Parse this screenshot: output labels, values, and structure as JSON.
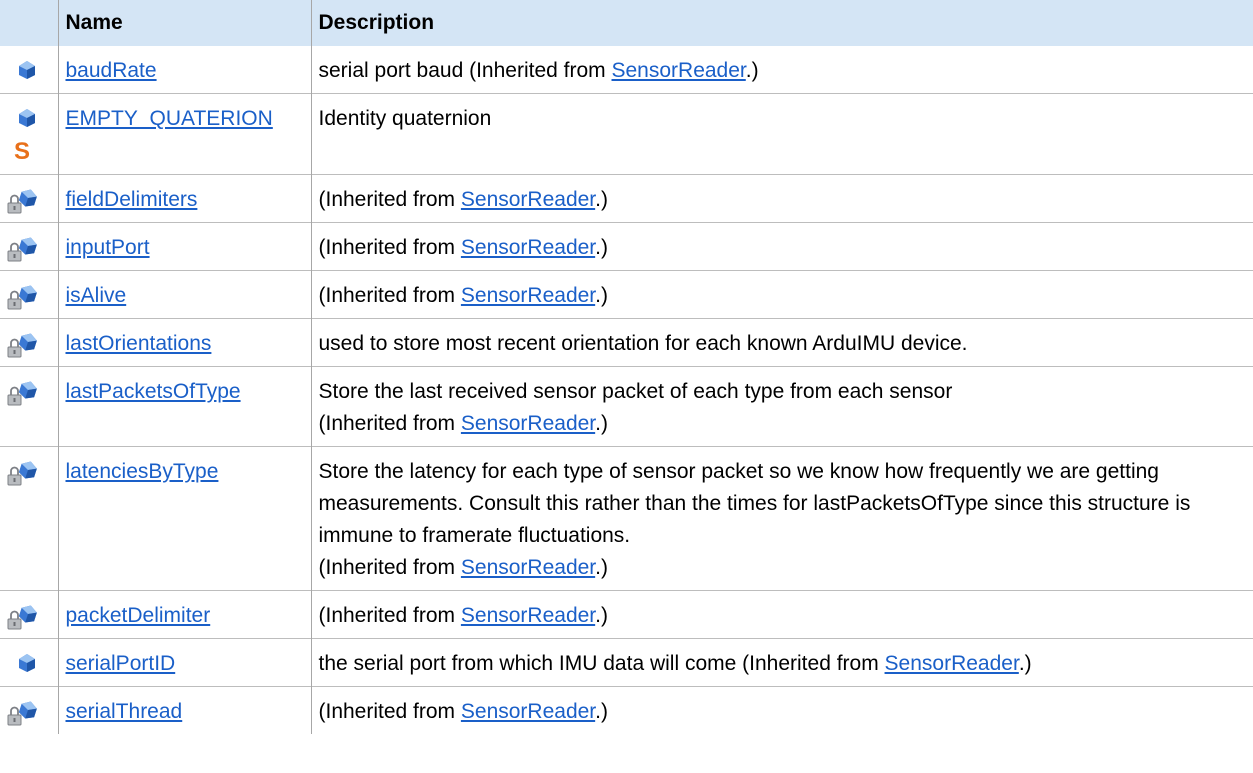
{
  "table": {
    "headers": {
      "name": "Name",
      "description": "Description"
    },
    "rows": [
      {
        "icon": "public-field-icon",
        "static": false,
        "name": "baudRate",
        "desc": "serial port baud",
        "inherited": true
      },
      {
        "icon": "public-field-icon",
        "static": true,
        "name": "EMPTY_QUATERION",
        "desc": "Identity quaternion",
        "inherited": false
      },
      {
        "icon": "protected-field-icon",
        "static": false,
        "name": "fieldDelimiters",
        "desc": "",
        "inherited": true
      },
      {
        "icon": "protected-field-icon",
        "static": false,
        "name": "inputPort",
        "desc": "",
        "inherited": true
      },
      {
        "icon": "protected-field-icon",
        "static": false,
        "name": "isAlive",
        "desc": "",
        "inherited": true
      },
      {
        "icon": "protected-field-icon",
        "static": false,
        "name": "lastOrientations",
        "desc": "used to store most recent orientation for each known ArduIMU device.",
        "inherited": false
      },
      {
        "icon": "protected-field-icon",
        "static": false,
        "name": "lastPacketsOfType",
        "desc": "Store the last received sensor packet of each type from each sensor",
        "inherited": true,
        "inheritedNewLine": true
      },
      {
        "icon": "protected-field-icon",
        "static": false,
        "name": "latenciesByType",
        "desc": "Store the latency for each type of sensor packet so we know how frequently we are getting measurements. Consult this rather than the times for lastPacketsOfType since this structure is immune to framerate fluctuations.",
        "inherited": true,
        "inheritedNewLine": true
      },
      {
        "icon": "protected-field-icon",
        "static": false,
        "name": "packetDelimiter",
        "desc": "",
        "inherited": true
      },
      {
        "icon": "public-field-icon",
        "static": false,
        "name": "serialPortID",
        "desc": "the serial port from which IMU data will come",
        "inherited": true
      },
      {
        "icon": "protected-field-icon",
        "static": false,
        "name": "serialThread",
        "desc": "",
        "inherited": true
      }
    ],
    "inherited_text": {
      "prefix": "(Inherited from ",
      "link": "SensorReader",
      "suffix": ".)"
    },
    "static_marker": "S"
  },
  "colors": {
    "header_bg": "#d4e5f5",
    "link": "#1a5fc8",
    "static_orange": "#e8701a",
    "icon_blue": "#3a78d4"
  }
}
